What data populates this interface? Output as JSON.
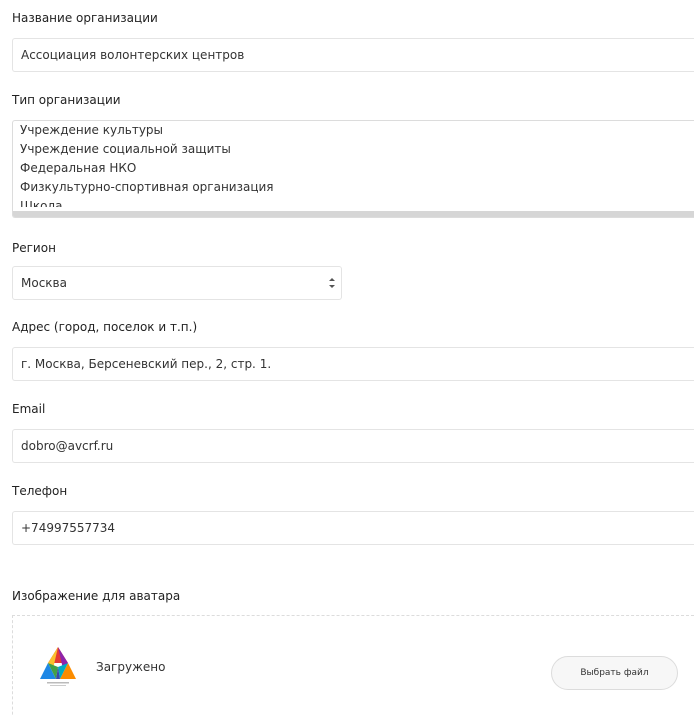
{
  "org_name": {
    "label": "Название организации",
    "value": "Ассоциация волонтерских центров"
  },
  "org_type": {
    "label": "Тип организации",
    "options": [
      "Учреждение культуры",
      "Учреждение социальной защиты",
      "Федеральная НКО",
      "Физкультурно-спортивная организация",
      "Школа"
    ]
  },
  "region": {
    "label": "Регион",
    "value": "Москва"
  },
  "address": {
    "label": "Адрес (город, поселок и т.п.)",
    "value": "г. Москва, Берсеневский пер., 2, стр. 1."
  },
  "email": {
    "label": "Email",
    "value": "dobro@avcrf.ru"
  },
  "phone": {
    "label": "Телефон",
    "value": "+74997557734"
  },
  "avatar": {
    "label": "Изображение для аватара",
    "status": "Загружено",
    "button_label": "Выбрать файл",
    "icon": "triangle-logo-icon"
  },
  "colors": {
    "border": "#e4e4e4",
    "text": "#333333"
  }
}
